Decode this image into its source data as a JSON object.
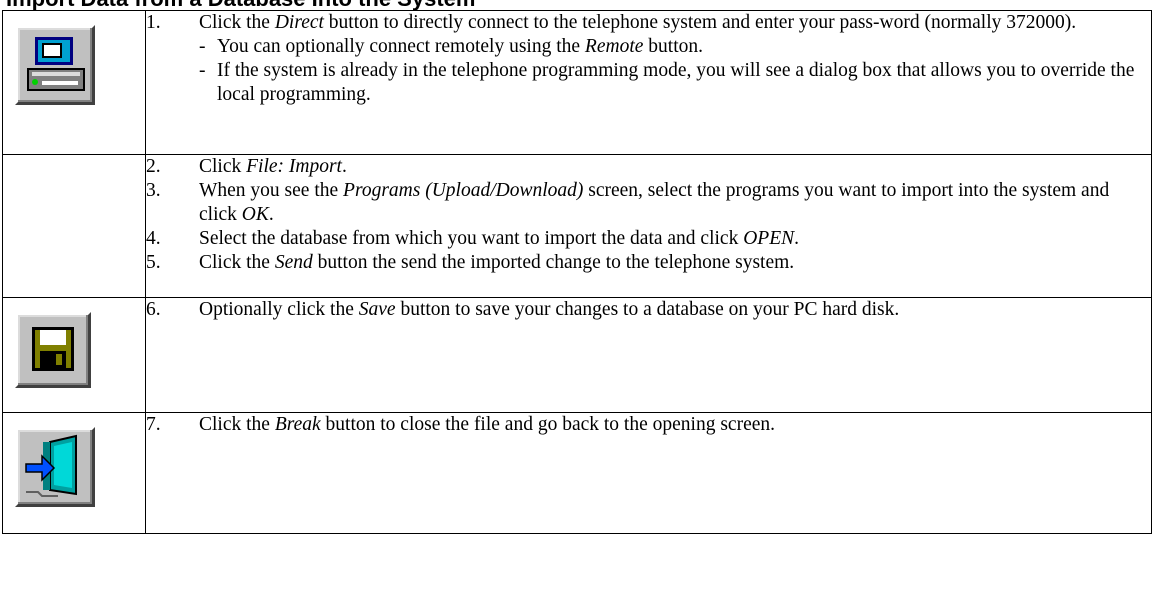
{
  "heading": "Import Data from a Database Into the System",
  "rows": [
    {
      "icon": "direct-connect-icon",
      "steps": [
        {
          "num": "1.",
          "parts": [
            {
              "t": "Click the "
            },
            {
              "t": "Direct",
              "i": true
            },
            {
              "t": " button to directly connect to the telephone system and enter your pass-word (normally 372000)."
            }
          ],
          "subs": [
            {
              "dash": "-",
              "parts": [
                {
                  "t": "You can optionally connect remotely using the "
                },
                {
                  "t": "Remote",
                  "i": true
                },
                {
                  "t": " button."
                }
              ]
            },
            {
              "dash": "-",
              "parts": [
                {
                  "t": "If the system is already in the telephone programming mode, you will see a dialog box that allows you to override the local programming."
                }
              ]
            }
          ]
        }
      ]
    },
    {
      "icon": "",
      "steps": [
        {
          "num": "2.",
          "parts": [
            {
              "t": "Click "
            },
            {
              "t": "File: Import",
              "i": true
            },
            {
              "t": "."
            }
          ]
        },
        {
          "num": "3.",
          "parts": [
            {
              "t": "When you see the "
            },
            {
              "t": "Programs (Upload/Download)",
              "i": true
            },
            {
              "t": " screen, select the programs you want to import into the system and click "
            },
            {
              "t": "OK",
              "i": true
            },
            {
              "t": "."
            }
          ]
        },
        {
          "num": "4.",
          "parts": [
            {
              "t": "Select the database from which you want to import the data and click "
            },
            {
              "t": "OPEN",
              "i": true
            },
            {
              "t": "."
            }
          ]
        },
        {
          "num": "5.",
          "parts": [
            {
              "t": "Click the "
            },
            {
              "t": "Send",
              "i": true
            },
            {
              "t": " button the send the imported change to the telephone system."
            }
          ]
        }
      ]
    },
    {
      "icon": "floppy-save-icon",
      "steps": [
        {
          "num": "6.",
          "parts": [
            {
              "t": "Optionally click the "
            },
            {
              "t": "Save",
              "i": true
            },
            {
              "t": " button to save your changes to a database on your PC hard disk."
            }
          ]
        }
      ]
    },
    {
      "icon": "exit-door-icon",
      "steps": [
        {
          "num": "7.",
          "parts": [
            {
              "t": "Click the "
            },
            {
              "t": "Break",
              "i": true
            },
            {
              "t": " button to close the file and go back to the opening screen."
            }
          ]
        }
      ]
    }
  ]
}
